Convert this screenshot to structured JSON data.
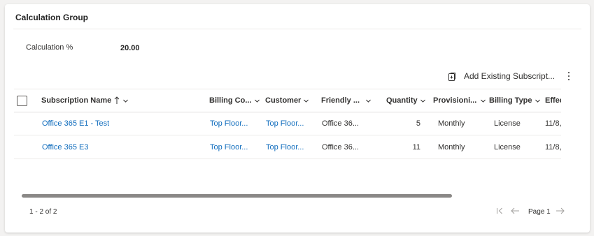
{
  "section": {
    "title": "Calculation Group"
  },
  "field": {
    "label": "Calculation %",
    "value": "20.00"
  },
  "commands": {
    "add_existing": "Add Existing Subscript...",
    "more_icon": "more-vertical-icon"
  },
  "grid": {
    "columns": [
      {
        "label": "Subscription Name",
        "sort": "ascending"
      },
      {
        "label": "Billing Co..."
      },
      {
        "label": "Customer"
      },
      {
        "label": "Friendly ..."
      },
      {
        "label": "Quantity"
      },
      {
        "label": "Provisioni..."
      },
      {
        "label": "Billing Type"
      },
      {
        "label": "Effect"
      }
    ],
    "rows": [
      {
        "name": "Office 365 E1 - Test",
        "billing_company": "Top Floor...",
        "customer": "Top Floor...",
        "friendly": "Office 36...",
        "quantity": "5",
        "provisioning": "Monthly",
        "billing_type": "License",
        "effective": "11/8,"
      },
      {
        "name": "Office 365 E3",
        "billing_company": "Top Floor...",
        "customer": "Top Floor...",
        "friendly": "Office 36...",
        "quantity": "11",
        "provisioning": "Monthly",
        "billing_type": "License",
        "effective": "11/8,"
      }
    ]
  },
  "pager": {
    "count": "1 - 2 of 2",
    "page": "Page 1"
  },
  "colors": {
    "link": "#0f6cbd",
    "scrollbar": "#8a8886"
  }
}
